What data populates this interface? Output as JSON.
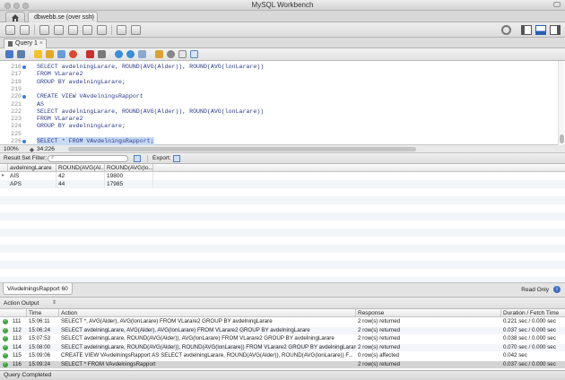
{
  "window": {
    "title": "MySQL Workbench"
  },
  "connection_tab": {
    "label": "dbwebb.se (over ssh)",
    "close": "×"
  },
  "query_tab": {
    "label": "Query 1",
    "close": "×"
  },
  "editor": {
    "lines": [
      {
        "num": "216",
        "dot": true,
        "text": "SELECT avdelningLarare, ROUND(AVG(Alder)), ROUND(AVG(lonLarare))",
        "selected": false
      },
      {
        "num": "217",
        "dot": false,
        "text": "FROM VLarare2",
        "selected": false
      },
      {
        "num": "218",
        "dot": false,
        "text": "GROUP BY avdelningLarare;",
        "selected": false
      },
      {
        "num": "219",
        "dot": false,
        "text": "",
        "selected": false
      },
      {
        "num": "220",
        "dot": true,
        "text": "CREATE VIEW VAvdelningsRapport",
        "selected": false
      },
      {
        "num": "221",
        "dot": false,
        "text": "AS",
        "selected": false
      },
      {
        "num": "222",
        "dot": false,
        "text": "SELECT avdelningLarare, ROUND(AVG(Alder)), ROUND(AVG(lonLarare))",
        "selected": false
      },
      {
        "num": "223",
        "dot": false,
        "text": "FROM VLarare2",
        "selected": false
      },
      {
        "num": "224",
        "dot": false,
        "text": "GROUP BY avdelningLarare;",
        "selected": false
      },
      {
        "num": "225",
        "dot": false,
        "text": "",
        "selected": false
      },
      {
        "num": "226",
        "dot": true,
        "text": "SELECT * FROM VAvdelningsRapport;",
        "selected": true
      }
    ]
  },
  "editor_status": {
    "zoom": "100%",
    "cursor": "34:226"
  },
  "result_toolbar": {
    "filter_label": "Result Set Filter:",
    "export_label": "Export:"
  },
  "grid": {
    "columns": [
      "avdelningLarare",
      "ROUND(AVG(Al...",
      "ROUND(AVG(lo..."
    ],
    "rows": [
      [
        "AIS",
        "42",
        "19800"
      ],
      [
        "APS",
        "44",
        "17985"
      ]
    ]
  },
  "result_tab": {
    "label": "VAvdelningsRapport 60",
    "read_only": "Read Only"
  },
  "action_output": {
    "title": "Action Output",
    "columns": [
      "Time",
      "Action",
      "Response",
      "Duration / Fetch Time"
    ],
    "rows": [
      {
        "num": "111",
        "time": "15:06:11",
        "action": "SELECT *, AVG(Alder), AVG(lonLarare)  FROM VLarare2 GROUP BY avdelningLarare",
        "response": "2 row(s) returned",
        "duration": "0.221 sec / 0.000 sec"
      },
      {
        "num": "112",
        "time": "15:06:24",
        "action": "SELECT avdelningLarare, AVG(Alder), AVG(lonLarare)  FROM VLarare2 GROUP BY avdelningLarare",
        "response": "2 row(s) returned",
        "duration": "0.037 sec / 0.000 sec"
      },
      {
        "num": "113",
        "time": "15:07:53",
        "action": "SELECT avdelningLarare, ROUND(AVG(Alder)), AVG(lonLarare)  FROM VLarare2 GROUP BY avdelningLarare",
        "response": "2 row(s) returned",
        "duration": "0.038 sec / 0.000 sec"
      },
      {
        "num": "114",
        "time": "15:08:00",
        "action": "SELECT avdelningLarare, ROUND(AVG(Alder)), ROUND(AVG(lonLarare))  FROM VLarare2 GROUP BY avdelningLarare",
        "response": "2 row(s) returned",
        "duration": "0.070 sec / 0.000 sec"
      },
      {
        "num": "115",
        "time": "15:09:06",
        "action": "CREATE VIEW VAvdelningsRapport AS SELECT avdelningLarare, ROUND(AVG(Alder)), ROUND(AVG(lonLarare))  F...",
        "response": "0 row(s) affected",
        "duration": "0.042 sec"
      },
      {
        "num": "116",
        "time": "15:09:24",
        "action": "SELECT * FROM VAvdelningsRapport",
        "response": "2 row(s) returned",
        "duration": "0.037 sec / 0.000 sec"
      }
    ]
  },
  "status_bar": {
    "text": "Query Completed"
  },
  "colors": {
    "selection": "#c7dbf6",
    "keyword": "#1f2f9e",
    "ok_green": "#3fa43f",
    "marker_blue": "#3c7cd6"
  },
  "icons": [
    "home-icon",
    "new-sql-icon",
    "open-sql-icon",
    "new-schema-icon",
    "new-table-icon",
    "new-view-icon",
    "new-routine-icon",
    "new-function-icon",
    "search-table-icon",
    "reconnect-icon",
    "settings-icon",
    "layout-left-icon",
    "layout-bottom-icon",
    "layout-right-icon"
  ]
}
